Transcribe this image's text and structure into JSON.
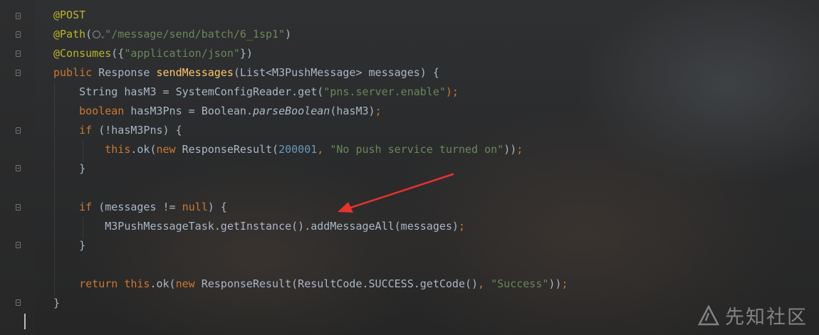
{
  "editor": {
    "lines": [
      {
        "segments": [
          {
            "t": "@POST",
            "c": "ann"
          }
        ]
      },
      {
        "segments": [
          {
            "t": "@Path",
            "c": "ann"
          },
          {
            "t": "(",
            "c": "plain"
          },
          {
            "icon": "globe-icon"
          },
          {
            "icon": "chevron-down-icon"
          },
          {
            "t": "\"/message/send/batch/6_1sp1\"",
            "c": "str"
          },
          {
            "t": ")",
            "c": "plain"
          }
        ]
      },
      {
        "segments": [
          {
            "t": "@Consumes",
            "c": "ann"
          },
          {
            "t": "({",
            "c": "plain"
          },
          {
            "t": "\"application/json\"",
            "c": "str"
          },
          {
            "t": "})",
            "c": "plain"
          }
        ]
      },
      {
        "segments": [
          {
            "t": "public ",
            "c": "kw"
          },
          {
            "t": "Response ",
            "c": "plain"
          },
          {
            "t": "sendMessages",
            "c": "fn"
          },
          {
            "t": "(List<M3PushMessage> messages) {",
            "c": "plain"
          }
        ]
      },
      {
        "segments": [
          {
            "t": "    String hasM3 = SystemConfigReader.get(",
            "c": "plain"
          },
          {
            "t": "\"pns.server.enable\"",
            "c": "str"
          },
          {
            "t": ");",
            "c": "kw"
          }
        ]
      },
      {
        "segments": [
          {
            "t": "    ",
            "c": "plain"
          },
          {
            "t": "boolean ",
            "c": "kw"
          },
          {
            "t": "hasM3Pns = Boolean.",
            "c": "plain"
          },
          {
            "t": "parseBoolean",
            "c": "it"
          },
          {
            "t": "(hasM3)",
            "c": "plain"
          },
          {
            "t": ";",
            "c": "kw"
          }
        ]
      },
      {
        "segments": [
          {
            "t": "    ",
            "c": "plain"
          },
          {
            "t": "if ",
            "c": "kw"
          },
          {
            "t": "(!hasM3Pns) {",
            "c": "plain"
          }
        ]
      },
      {
        "segments": [
          {
            "t": "        ",
            "c": "plain"
          },
          {
            "t": "this",
            "c": "kw"
          },
          {
            "t": ".ok(",
            "c": "plain"
          },
          {
            "t": "new ",
            "c": "kw"
          },
          {
            "t": "ResponseResult(",
            "c": "plain"
          },
          {
            "t": "200001",
            "c": "num"
          },
          {
            "t": ", ",
            "c": "kw"
          },
          {
            "t": "\"No push service turned on\"",
            "c": "str"
          },
          {
            "t": "))",
            "c": "plain"
          },
          {
            "t": ";",
            "c": "kw"
          }
        ]
      },
      {
        "segments": [
          {
            "t": "    }",
            "c": "plain"
          }
        ]
      },
      {
        "segments": []
      },
      {
        "segments": [
          {
            "t": "    ",
            "c": "plain"
          },
          {
            "t": "if ",
            "c": "kw"
          },
          {
            "t": "(messages != ",
            "c": "plain"
          },
          {
            "t": "null",
            "c": "kw"
          },
          {
            "t": ") {",
            "c": "plain"
          }
        ]
      },
      {
        "segments": [
          {
            "t": "        M3PushMessageTask.getInstance().addMessageAll(messages)",
            "c": "plain"
          },
          {
            "t": ";",
            "c": "kw"
          }
        ]
      },
      {
        "segments": [
          {
            "t": "    }",
            "c": "plain"
          }
        ]
      },
      {
        "segments": []
      },
      {
        "segments": [
          {
            "t": "    ",
            "c": "plain"
          },
          {
            "t": "return this",
            "c": "kw"
          },
          {
            "t": ".ok(",
            "c": "plain"
          },
          {
            "t": "new ",
            "c": "kw"
          },
          {
            "t": "ResponseResult(ResultCode.SUCCESS.getCode()",
            "c": "plain"
          },
          {
            "t": ", ",
            "c": "kw"
          },
          {
            "t": "\"Success\"",
            "c": "str"
          },
          {
            "t": "))",
            "c": "plain"
          },
          {
            "t": ";",
            "c": "kw"
          }
        ]
      },
      {
        "segments": [
          {
            "t": "}",
            "c": "plain"
          }
        ]
      }
    ]
  },
  "annotation": {
    "arrow_color": "#e8322d",
    "points_to": "M3PushMessageTask.getInstance().addMessageAll(messages)"
  },
  "watermark": {
    "text": "先知社区",
    "icon": "xianzhi-logo-icon"
  },
  "colors": {
    "background": "#2b2b2b",
    "default_text": "#a9b7c6",
    "annotation": "#bbb529",
    "keyword": "#cc7832",
    "string": "#6a8759",
    "number": "#6897bb",
    "method_declaration": "#ffc66d"
  }
}
